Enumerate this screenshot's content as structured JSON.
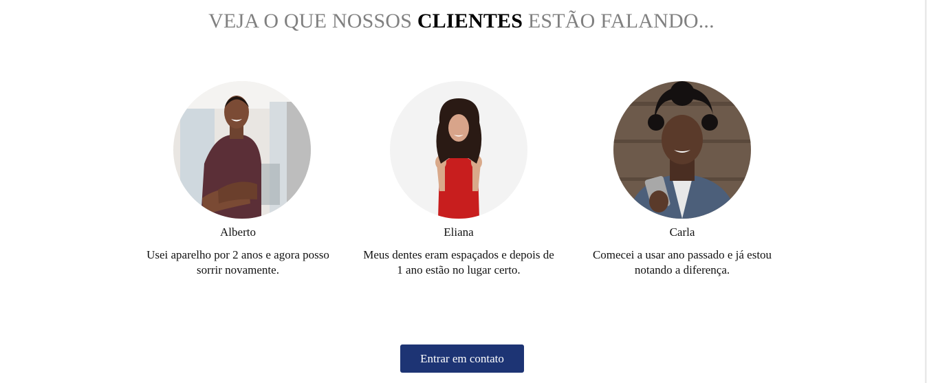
{
  "heading": {
    "prefix": "VEJA O QUE NOSSOS",
    "highlight": "CLIENTES",
    "suffix": "ESTÃO FALANDO..."
  },
  "testimonials": [
    {
      "name": "Alberto",
      "quote": "Usei aparelho por 2 anos e agora posso sorrir novamente."
    },
    {
      "name": "Eliana",
      "quote": "Meus dentes eram espaçados e depois de 1 ano estão no lugar certo."
    },
    {
      "name": "Carla",
      "quote": "Comecei a usar ano passado e já estou notando a diferença."
    }
  ],
  "cta": {
    "label": "Entrar em contato"
  },
  "colors": {
    "accent": "#1d3474",
    "heading_muted": "#808080"
  }
}
